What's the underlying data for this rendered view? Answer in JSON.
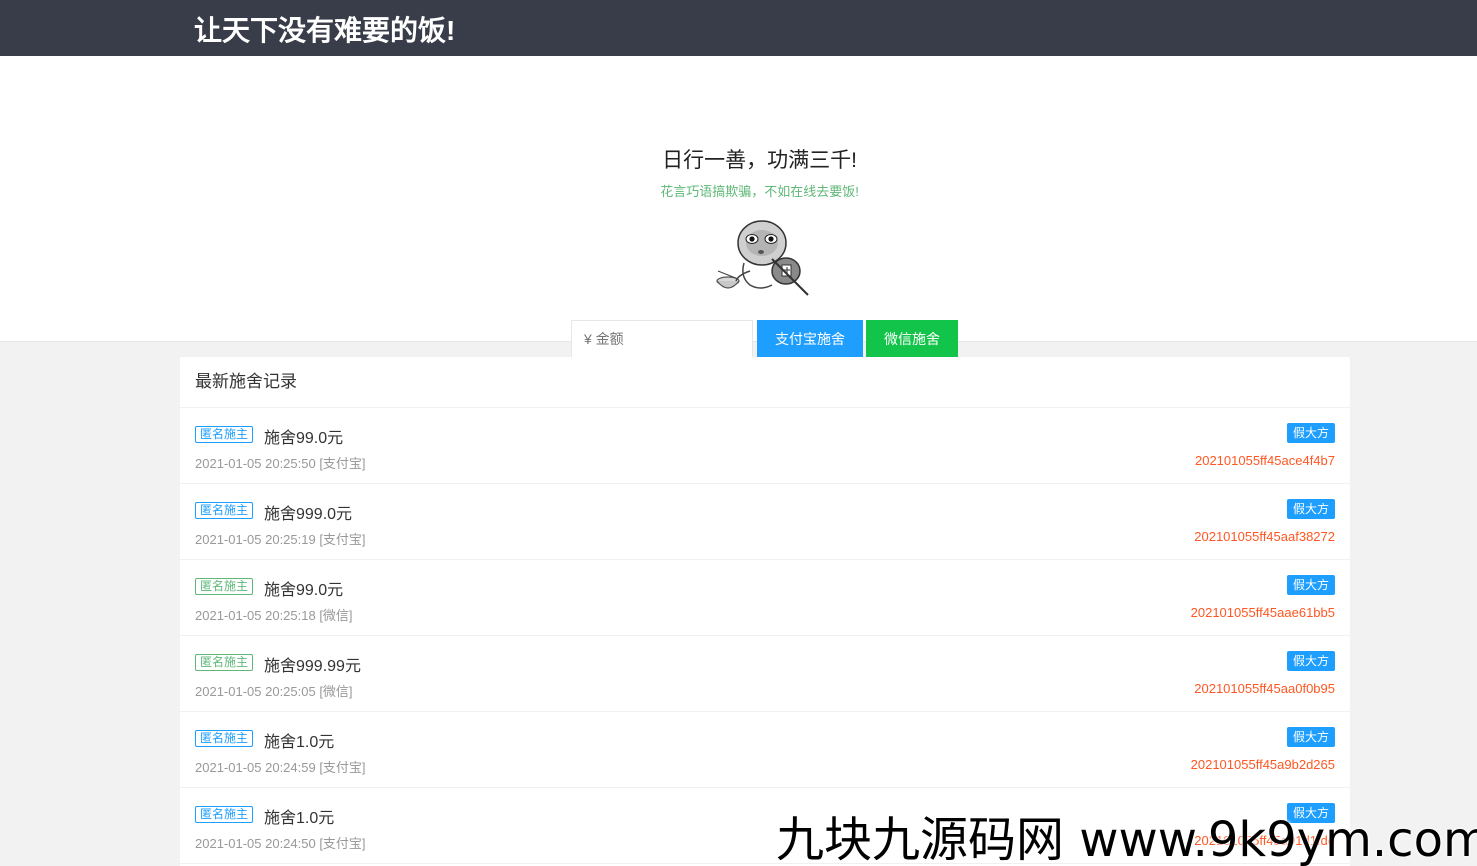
{
  "header": {
    "title": "让天下没有难要的饭!"
  },
  "hero": {
    "motto": "日行一善，功满三千!",
    "subtitle": "花言巧语搞欺骗，不如在线去要饭!",
    "mascot_icon": "beggar-mascot-icon"
  },
  "form": {
    "amount_placeholder": "¥ 金额",
    "alipay_label": "支付宝施舍",
    "wechat_label": "微信施舍"
  },
  "records": {
    "title": "最新施舍记录",
    "items": [
      {
        "tag": "匿名施主",
        "channel": "alipay",
        "amount": "施舍99.0元",
        "meta": "2021-01-05 20:25:50 [支付宝]",
        "badge": "假大方",
        "order": "202101055ff45ace4f4b7"
      },
      {
        "tag": "匿名施主",
        "channel": "alipay",
        "amount": "施舍999.0元",
        "meta": "2021-01-05 20:25:19 [支付宝]",
        "badge": "假大方",
        "order": "202101055ff45aaf38272"
      },
      {
        "tag": "匿名施主",
        "channel": "wechat",
        "amount": "施舍99.0元",
        "meta": "2021-01-05 20:25:18 [微信]",
        "badge": "假大方",
        "order": "202101055ff45aae61bb5"
      },
      {
        "tag": "匿名施主",
        "channel": "wechat",
        "amount": "施舍999.99元",
        "meta": "2021-01-05 20:25:05 [微信]",
        "badge": "假大方",
        "order": "202101055ff45aa0f0b95"
      },
      {
        "tag": "匿名施主",
        "channel": "alipay",
        "amount": "施舍1.0元",
        "meta": "2021-01-05 20:24:59 [支付宝]",
        "badge": "假大方",
        "order": "202101055ff45a9b2d265"
      },
      {
        "tag": "匿名施主",
        "channel": "alipay",
        "amount": "施舍1.0元",
        "meta": "2021-01-05 20:24:50 [支付宝]",
        "badge": "假大方",
        "order": "202101055ff45a91d1fde"
      }
    ]
  },
  "watermark": "九块九源码网 www.9k9ym.com",
  "colors": {
    "header_bg": "#393d49",
    "alipay_blue": "#1e9fff",
    "wechat_green": "#13c44a",
    "order_orange": "#ff5722"
  }
}
